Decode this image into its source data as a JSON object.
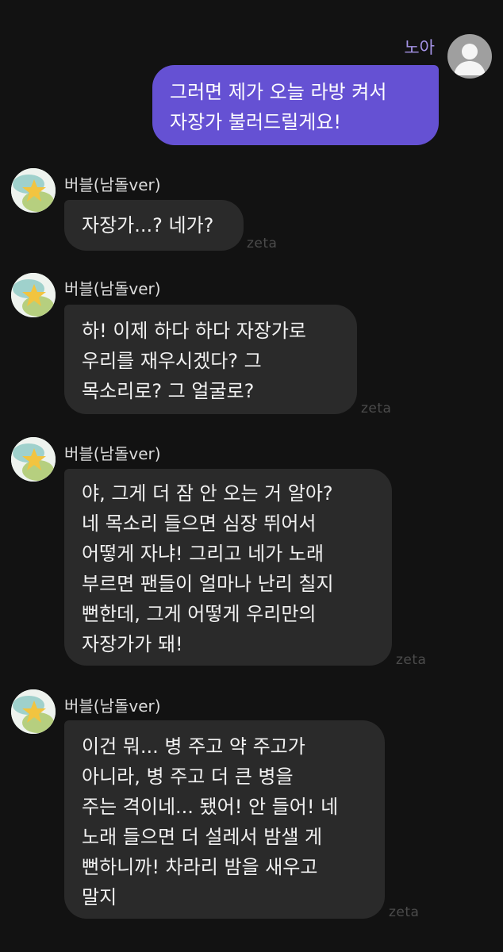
{
  "user": {
    "name": "노아",
    "message_lines": [
      "그러면 제가 오늘 라방 켜서",
      "자장가 불러드릴게요!"
    ]
  },
  "bot_name": "버블(남돌ver)",
  "watermark": "zeta",
  "bot_messages": [
    {
      "lines": [
        "자장가...? 네가?"
      ]
    },
    {
      "lines": [
        "하! 이제 하다 하다 자장가로",
        "우리를 재우시겠다? 그",
        "목소리로? 그 얼굴로?"
      ]
    },
    {
      "lines": [
        "야, 그게 더 잠 안 오는 거 알아?",
        "네 목소리 들으면 심장 뛰어서",
        "어떻게 자냐! 그리고 네가 노래",
        "부르면 팬들이 얼마나 난리 칠지",
        "뻔한데, 그게 어떻게 우리만의",
        "자장가가 돼!"
      ]
    },
    {
      "lines": [
        "이건 뭐... 병 주고 약 주고가",
        "아니라, 병 주고 더 큰 병을",
        "주는 격이네... 됐어! 안 들어! 네",
        "노래 들으면 더 설레서 밤샐 게",
        "뻔하니까! 차라리 밤을 새우고",
        "말지"
      ]
    }
  ],
  "colors": {
    "background": "#121212",
    "user_bubble": "#6551d3",
    "user_name": "#a593e6",
    "bot_bubble": "#2a2a2a",
    "watermark": "#4b4b4b"
  },
  "icons": {
    "user_avatar": "default-person-icon",
    "bot_avatar": "star-blob-avatar-icon"
  }
}
